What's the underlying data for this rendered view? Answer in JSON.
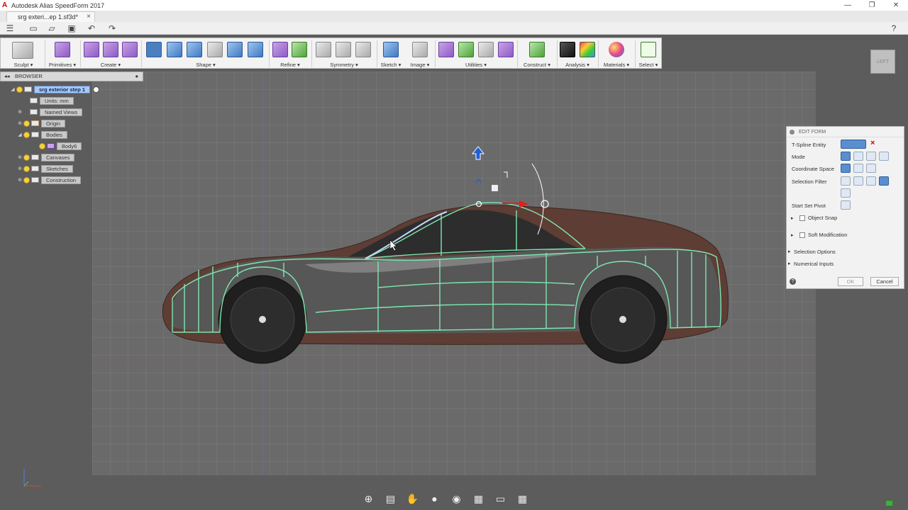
{
  "window": {
    "title": "Autodesk Alias SpeedForm 2017",
    "doc_tab": "srg exteri...ep 1.sf3d*",
    "controls": [
      "—",
      "❐",
      "✕"
    ]
  },
  "ribbon": {
    "groups": [
      {
        "label": "Sculpt ▾"
      },
      {
        "label": "Primitives ▾"
      },
      {
        "label": "Create ▾"
      },
      {
        "label": "Shape ▾"
      },
      {
        "label": "Refine ▾"
      },
      {
        "label": "Symmetry ▾"
      },
      {
        "label": "Sketch ▾"
      },
      {
        "label": "Image ▾"
      },
      {
        "label": "Utilities ▾"
      },
      {
        "label": "Construct ▾"
      },
      {
        "label": "Analysis ▾"
      },
      {
        "label": "Materials ▾"
      },
      {
        "label": "Select ▾"
      }
    ]
  },
  "browser": {
    "title": "BROWSER",
    "root": "srg exterior step 1",
    "items": [
      {
        "label": "Units: mm"
      },
      {
        "label": "Named Views"
      },
      {
        "label": "Origin"
      },
      {
        "label": "Bodies"
      },
      {
        "label": "Body6"
      },
      {
        "label": "Canvases"
      },
      {
        "label": "Sketches"
      },
      {
        "label": "Construction"
      }
    ]
  },
  "viewcube": {
    "label": "LEFT"
  },
  "edit_form": {
    "title": "EDIT FORM",
    "tspline_entity": "T-Spline Entity",
    "mode": "Mode",
    "coordinate_space": "Coordinate Space",
    "selection_filter": "Selection Filter",
    "start_set_pivot": "Start Set Pivot",
    "object_snap": "Object Snap",
    "soft_modification": "Soft Modification",
    "selection_options": "Selection Options",
    "numerical_inputs": "Numerical Inputs",
    "ok": "OK",
    "cancel": "Cancel"
  },
  "icons": {
    "help": "help-icon",
    "app": "autodesk-logo-icon"
  },
  "colors": {
    "wireframe": "#7de8b0",
    "car_body": "#6b4238",
    "selected_edge": "#c8d8ff",
    "gizmo_up": "#1f5fd6",
    "gizmo_right": "#e02020"
  }
}
